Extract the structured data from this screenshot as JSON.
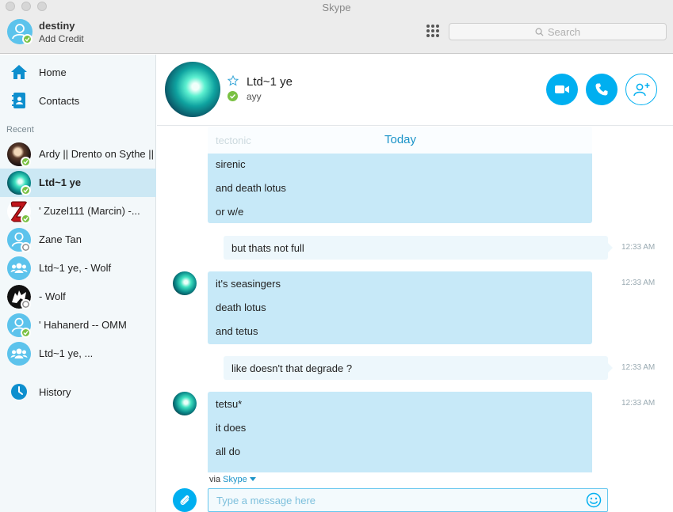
{
  "window": {
    "title": "Skype"
  },
  "profile": {
    "name": "destiny",
    "credit_label": "Add Credit"
  },
  "search": {
    "placeholder": "Search"
  },
  "nav": {
    "home": "Home",
    "contacts": "Contacts",
    "recent_heading": "Recent",
    "history": "History"
  },
  "recent": [
    {
      "name": "Ardy || Drento on Sythe ||",
      "status": "online",
      "avatar": "dark-photo"
    },
    {
      "name": "Ltd~1 ye",
      "status": "online",
      "avatar": "teal-photo",
      "active": true
    },
    {
      "name": "' Zuzel111 (Marcin) -...",
      "status": "online",
      "avatar": "red-z"
    },
    {
      "name": "Zane Tan",
      "status": "offline",
      "avatar": "default-user"
    },
    {
      "name": "Ltd~1 ye, - Wolf",
      "status": "none",
      "avatar": "group"
    },
    {
      "name": "- Wolf",
      "status": "offline",
      "avatar": "wolf-photo"
    },
    {
      "name": "' Hahanerd -- OMM",
      "status": "online",
      "avatar": "default-user"
    },
    {
      "name": "Ltd~1 ye, ...",
      "status": "none",
      "avatar": "group"
    }
  ],
  "chat": {
    "name": "Ltd~1 ye",
    "mood": "ayy",
    "day_label": "Today",
    "faded_line": "tectonic",
    "messages": [
      {
        "from": "them",
        "lines": [
          "sirenic",
          "and death lotus",
          "or w/e"
        ],
        "time": ""
      },
      {
        "from": "me",
        "lines": [
          "but thats not full"
        ],
        "time": "12:33 AM"
      },
      {
        "from": "them",
        "lines": [
          "it's seasingers",
          "death lotus",
          "and tetus"
        ],
        "time": "12:33 AM"
      },
      {
        "from": "me",
        "lines": [
          "like doesn't that degrade ?"
        ],
        "time": "12:33 AM"
      },
      {
        "from": "them",
        "lines": [
          "tetsu*",
          "it does",
          "all do"
        ],
        "time": "12:33 AM"
      }
    ]
  },
  "composer": {
    "via_prefix": "via",
    "via_service": "Skype",
    "placeholder": "Type a message here"
  },
  "colors": {
    "accent": "#00aff0",
    "online": "#7ac143",
    "bubble_in": "#c7e9f8",
    "bubble_out": "#edf7fc"
  }
}
